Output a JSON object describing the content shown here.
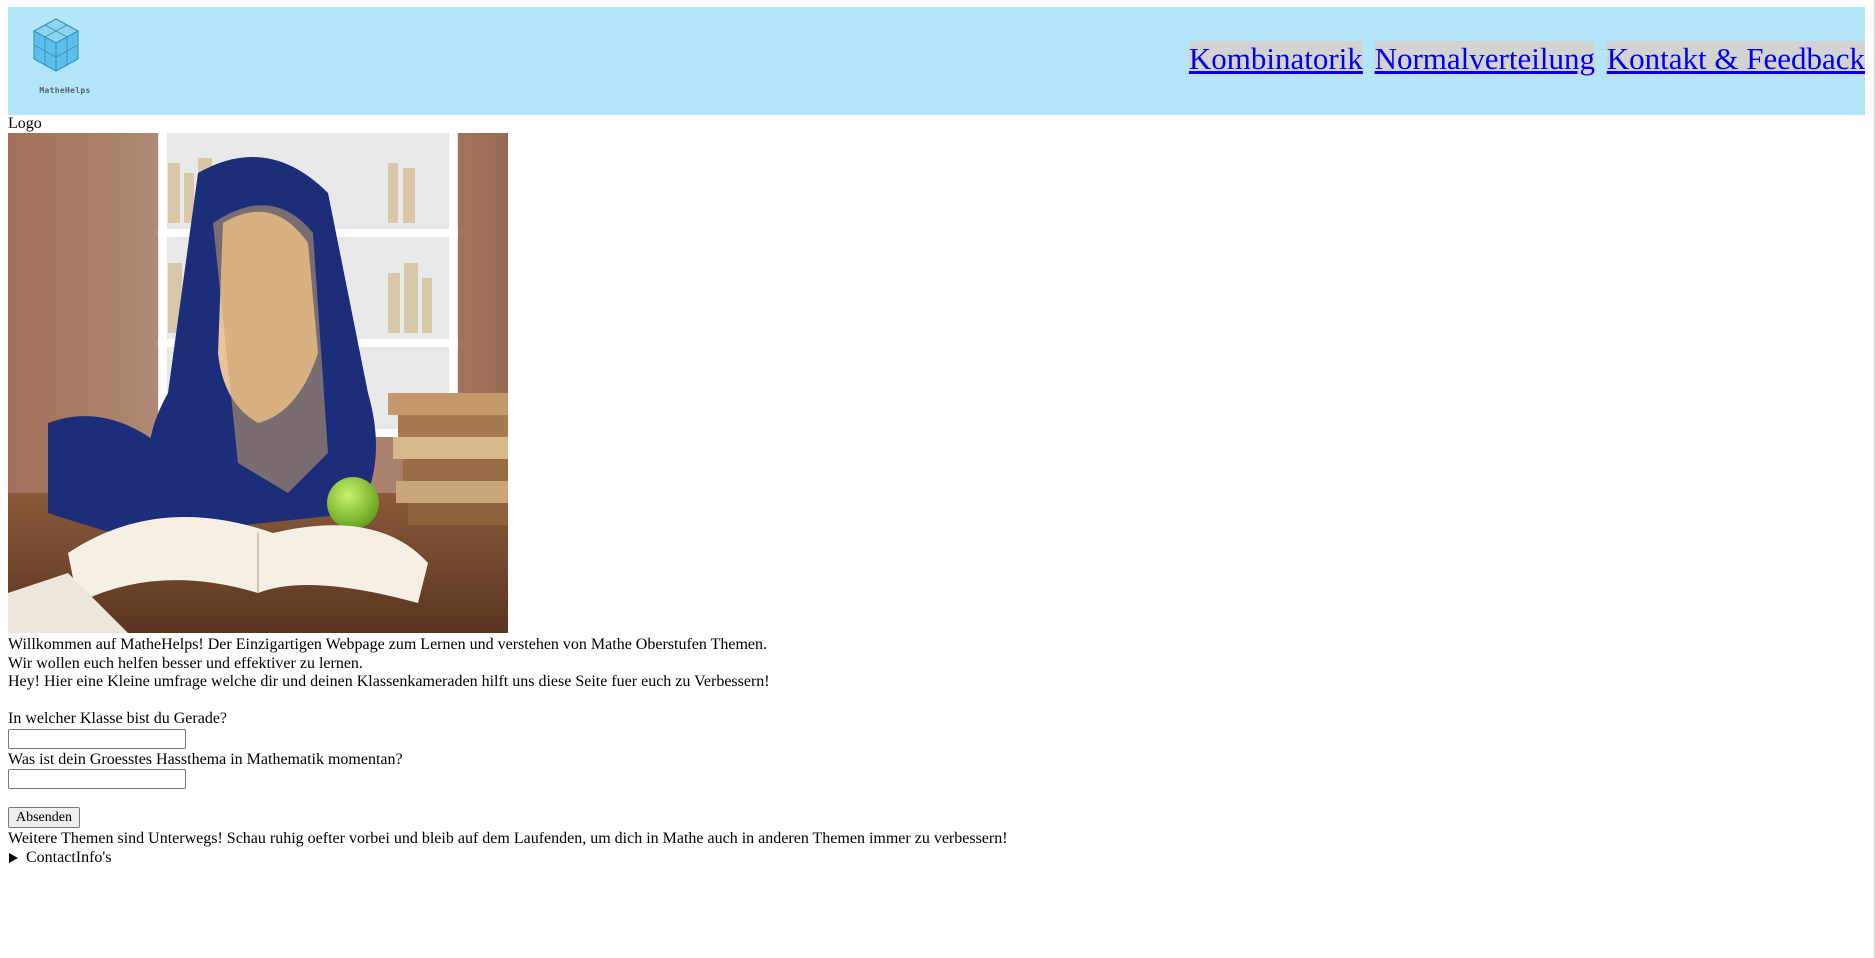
{
  "header": {
    "logo_text": "MatheHelps",
    "nav": [
      "Kombinatorik",
      "Normalverteilung",
      "Kontakt & Feedback"
    ]
  },
  "logo_alt": "Logo",
  "intro": {
    "line1": "Willkommen auf MatheHelps! Der Einzigartigen Webpage zum Lernen und verstehen von Mathe Oberstufen Themen.",
    "line2": "Wir wollen euch helfen besser und effektiver zu lernen.",
    "line3": "Hey! Hier eine Kleine umfrage welche dir und deinen Klassenkameraden hilft uns diese Seite fuer euch zu Verbessern!"
  },
  "survey": {
    "q1": "In welcher Klasse bist du Gerade?",
    "q1_value": "",
    "q2": "Was ist dein Groesstes Hassthema in Mathematik momentan?",
    "q2_value": "",
    "submit": "Absenden"
  },
  "footer": {
    "more_topics": "Weitere Themen sind Unterwegs! Schau ruhig oefter vorbei und bleib auf dem Laufenden, um dich in Mathe auch in anderen Themen immer zu verbessern!",
    "contact_summary": "ContactInfo's"
  },
  "colors": {
    "header_bg": "#b3e5fb",
    "link": "#0000ee",
    "nav_highlight": "#d3d3d3"
  }
}
